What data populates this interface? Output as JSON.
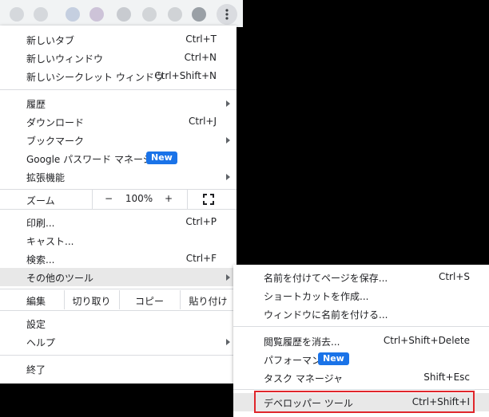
{
  "colors": {
    "accent": "#1a73e8",
    "highlight_border": "#e0262b",
    "hover_bg": "#e8e8e8"
  },
  "toolbar": {
    "menu_icon": "kebab-icon"
  },
  "menu": {
    "new_tab": {
      "label": "新しいタブ",
      "shortcut": "Ctrl+T"
    },
    "new_window": {
      "label": "新しいウィンドウ",
      "shortcut": "Ctrl+N"
    },
    "incognito": {
      "label": "新しいシークレット ウィンドウ",
      "shortcut": "Ctrl+Shift+N"
    },
    "history": {
      "label": "履歴"
    },
    "downloads": {
      "label": "ダウンロード",
      "shortcut": "Ctrl+J"
    },
    "bookmarks": {
      "label": "ブックマーク"
    },
    "password_manager": {
      "label": "Google パスワード マネージャー",
      "badge": "New"
    },
    "extensions": {
      "label": "拡張機能"
    },
    "zoom": {
      "label": "ズーム",
      "minus": "−",
      "value": "100%",
      "plus": "+"
    },
    "print": {
      "label": "印刷...",
      "shortcut": "Ctrl+P"
    },
    "cast": {
      "label": "キャスト..."
    },
    "find": {
      "label": "検索...",
      "shortcut": "Ctrl+F"
    },
    "more_tools": {
      "label": "その他のツール"
    },
    "edit": {
      "label": "編集",
      "cut": "切り取り",
      "copy": "コピー",
      "paste": "貼り付け"
    },
    "settings": {
      "label": "設定"
    },
    "help": {
      "label": "ヘルプ"
    },
    "exit": {
      "label": "終了"
    }
  },
  "submenu": {
    "save_page": {
      "label": "名前を付けてページを保存...",
      "shortcut": "Ctrl+S"
    },
    "create_shortcut": {
      "label": "ショートカットを作成..."
    },
    "name_window": {
      "label": "ウィンドウに名前を付ける..."
    },
    "clear_data": {
      "label": "閲覧履歴を消去...",
      "shortcut": "Ctrl+Shift+Delete"
    },
    "performance": {
      "label": "パフォーマンス",
      "badge": "New"
    },
    "task_manager": {
      "label": "タスク マネージャ",
      "shortcut": "Shift+Esc"
    },
    "devtools": {
      "label": "デベロッパー ツール",
      "shortcut": "Ctrl+Shift+I"
    }
  }
}
